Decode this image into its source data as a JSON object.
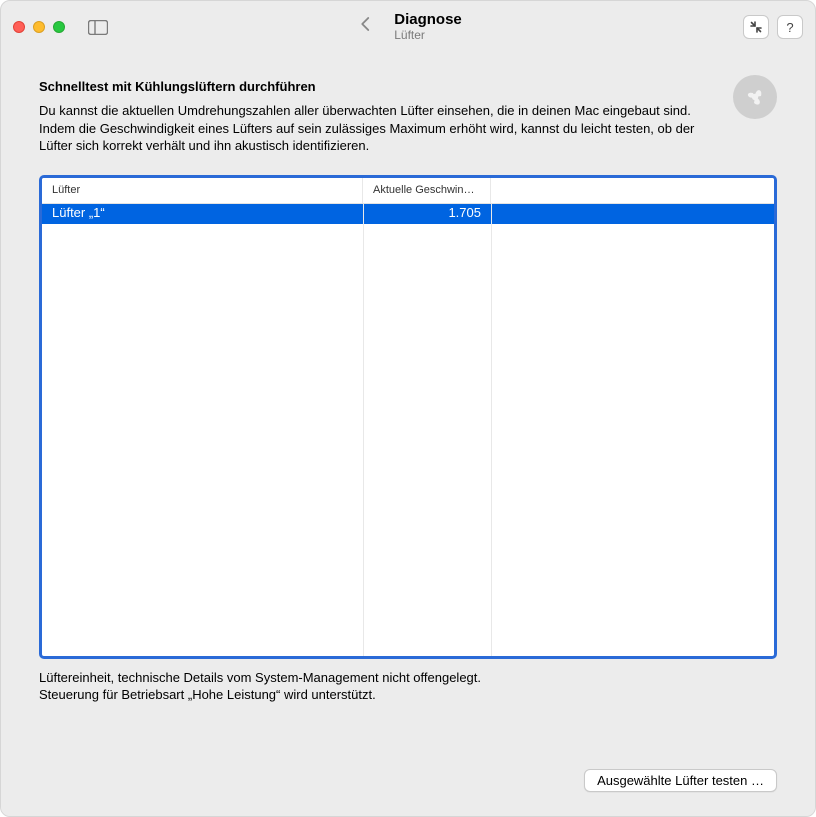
{
  "window": {
    "title": "Diagnose",
    "subtitle": "Lüfter"
  },
  "toolbar": {
    "back_aria": "Zurück",
    "collapse_aria": "Verkleinern",
    "help_label": "?"
  },
  "main": {
    "heading": "Schnelltest mit Kühlungslüftern durchführen",
    "description": "Du kannst die aktuellen Umdrehungszahlen aller überwachten Lüfter einsehen, die in deinen Mac eingebaut sind. Indem die Geschwindigkeit eines Lüfters auf sein zulässiges Maximum erhöht wird, kannst du leicht testen, ob der Lüfter sich korrekt verhält und ihn akustisch identifizieren."
  },
  "table": {
    "columns": [
      "Lüfter",
      "Aktuelle Geschwindi…",
      ""
    ],
    "rows": [
      {
        "name": "Lüfter „1“",
        "speed": "1.705",
        "extra": "",
        "selected": true
      }
    ]
  },
  "footer": {
    "line1": "Lüftereinheit, technische Details vom System-Management nicht offengelegt.",
    "line2": "Steuerung für Betriebsart „Hohe Leistung“ wird unterstützt."
  },
  "actions": {
    "test_button": "Ausgewählte Lüfter testen …"
  }
}
